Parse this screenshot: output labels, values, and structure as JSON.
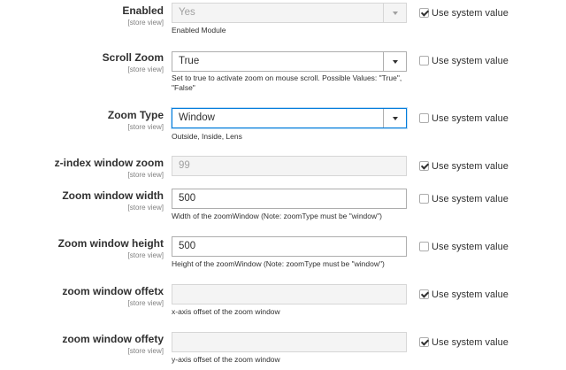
{
  "scope_label": "[store view]",
  "use_system_label": "Use system value",
  "rows": [
    {
      "label": "Enabled",
      "value": "Yes",
      "note": "Enabled Module",
      "use_system": true
    },
    {
      "label": "Scroll Zoom",
      "value": "True",
      "note": "Set to true to activate zoom on mouse scroll. Possible Values: \"True\", \"False\"",
      "use_system": false
    },
    {
      "label": "Zoom Type",
      "value": "Window",
      "note": "Outside, Inside, Lens",
      "use_system": false
    },
    {
      "label": "z-index window zoom",
      "value": "99",
      "note": "",
      "use_system": true
    },
    {
      "label": "Zoom window width",
      "value": "500",
      "note": "Width of the zoomWindow (Note: zoomType must be \"window\")",
      "use_system": false
    },
    {
      "label": "Zoom window height",
      "value": "500",
      "note": "Height of the zoomWindow (Note: zoomType must be \"window\")",
      "use_system": false
    },
    {
      "label": "zoom window offetx",
      "value": "",
      "note": "x-axis offset of the zoom window",
      "use_system": true
    },
    {
      "label": "zoom window offety",
      "value": "",
      "note": "y-axis offset of the zoom window",
      "use_system": true
    }
  ]
}
